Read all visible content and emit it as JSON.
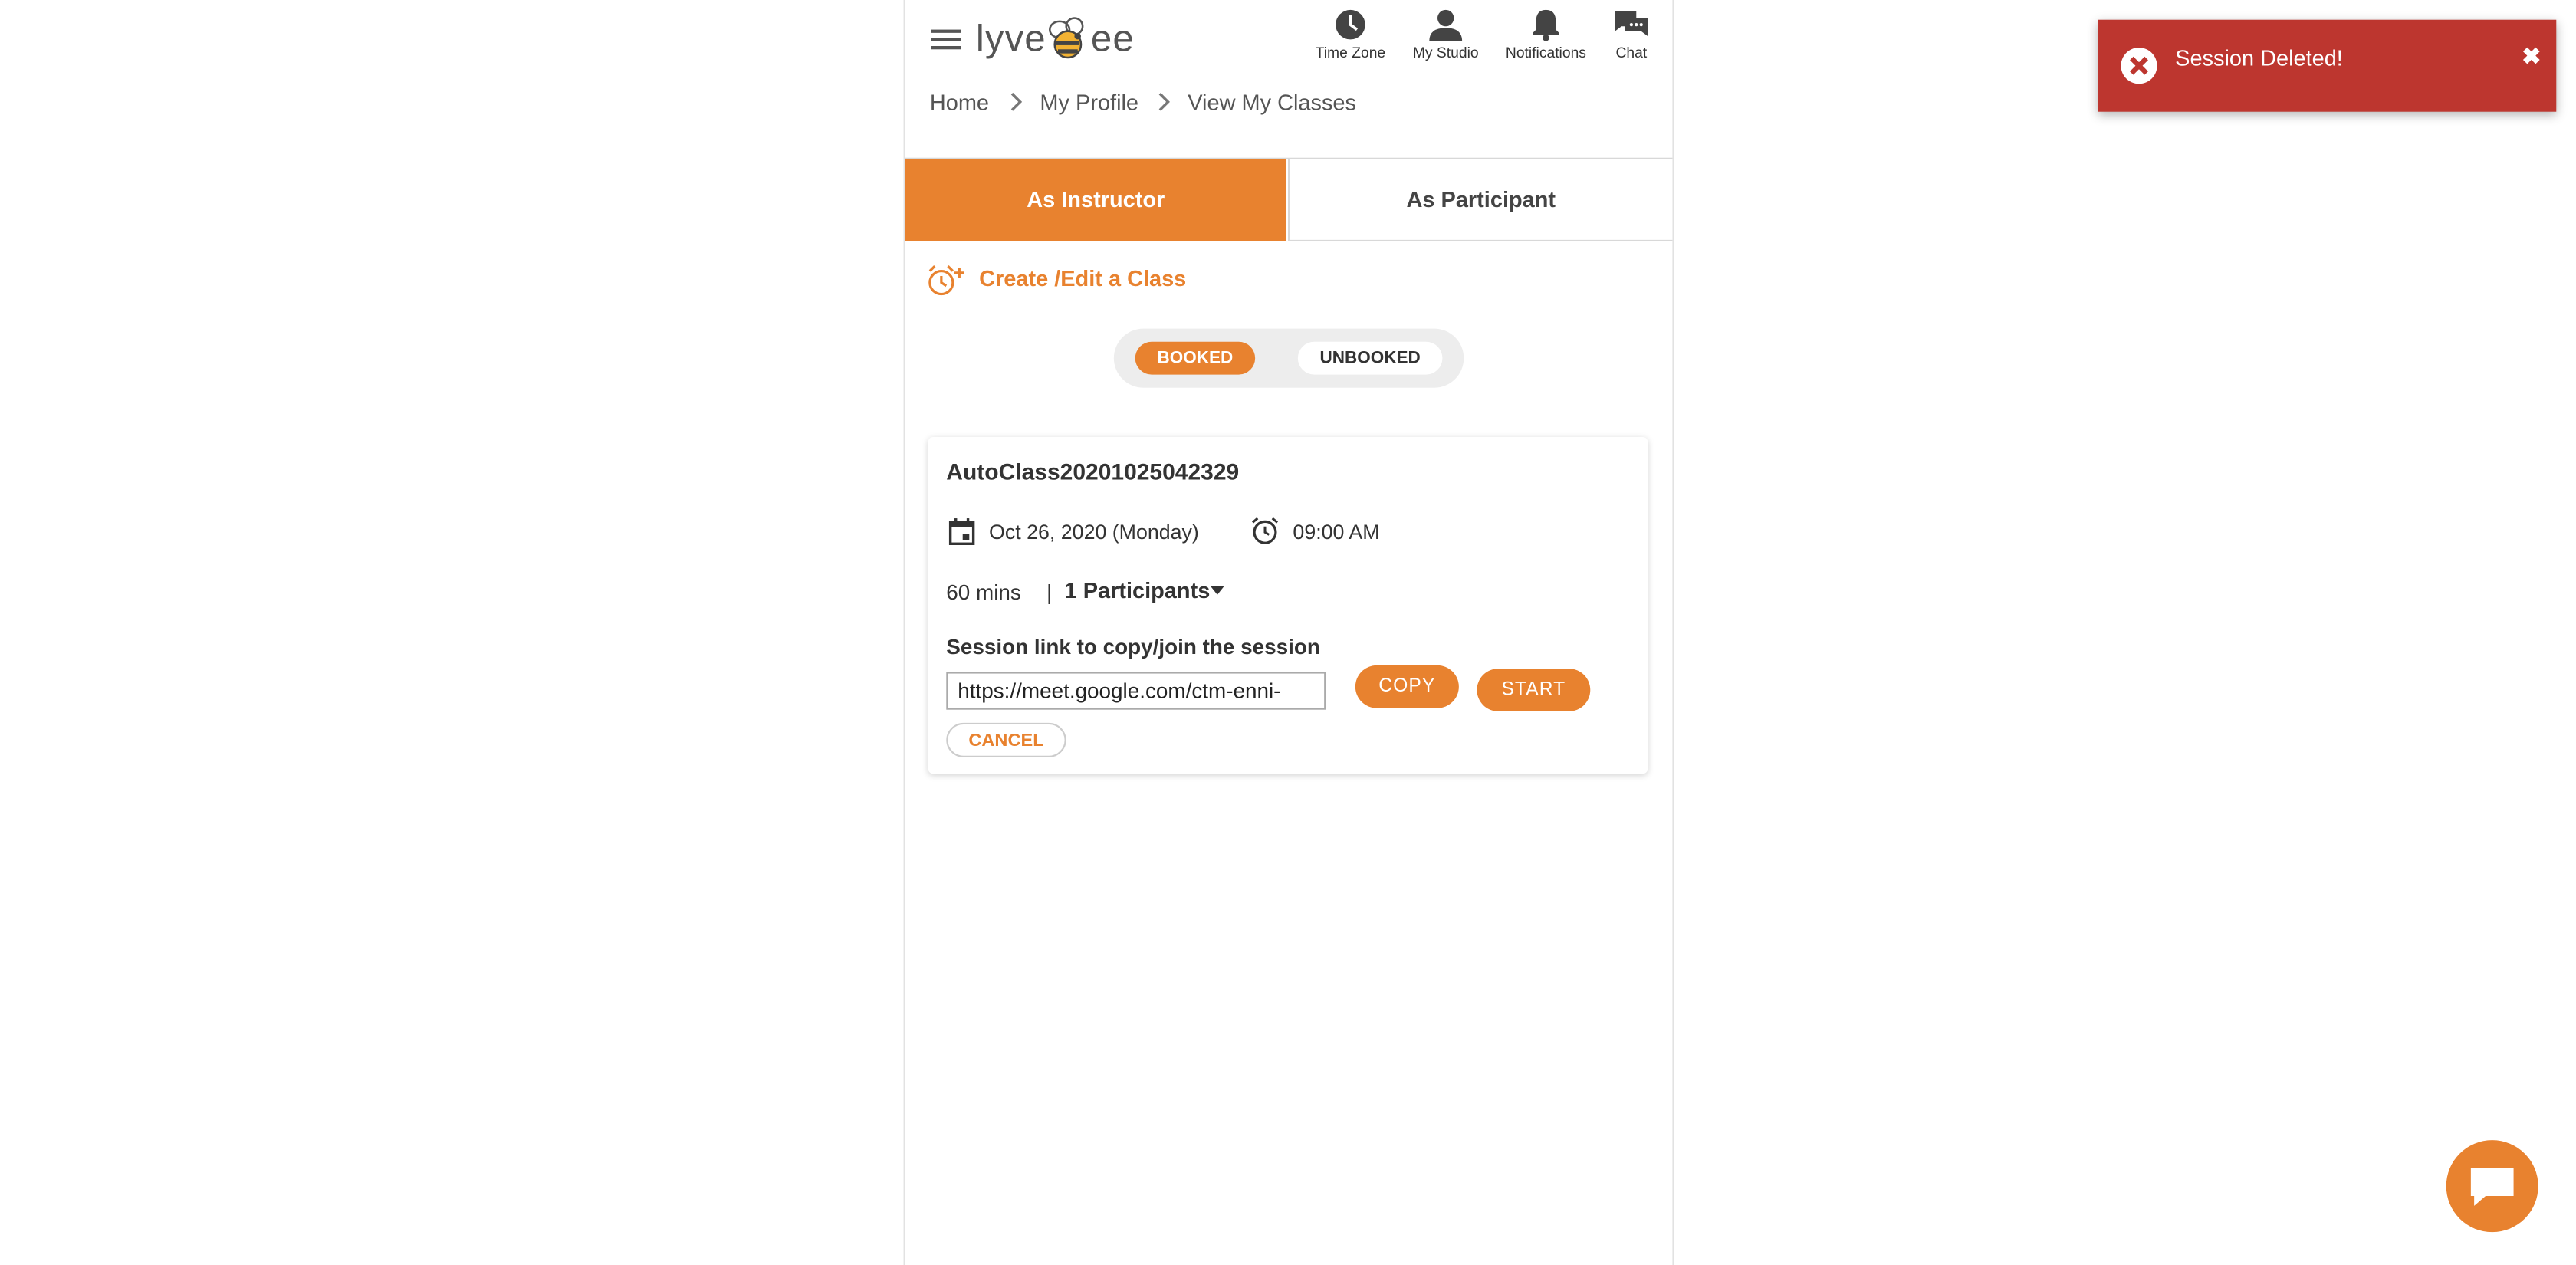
{
  "header": {
    "logo_text": "lyve",
    "logo_suffix": "ee",
    "icons": [
      {
        "label": "Time Zone",
        "icon": "clock-icon"
      },
      {
        "label": "My Studio",
        "icon": "person-icon"
      },
      {
        "label": "Notifications",
        "icon": "bell-icon"
      },
      {
        "label": "Chat",
        "icon": "chat-bubbles-icon"
      }
    ]
  },
  "breadcrumb": [
    "Home",
    "My Profile",
    "View My Classes"
  ],
  "tabs": [
    {
      "label": "As Instructor",
      "active": true
    },
    {
      "label": "As Participant",
      "active": false
    }
  ],
  "create_link": "Create /Edit a Class",
  "filter": {
    "booked": "BOOKED",
    "unbooked": "UNBOOKED",
    "selected": "BOOKED"
  },
  "class_card": {
    "title": "AutoClass20201025042329",
    "date": "Oct 26, 2020",
    "weekday": "(Monday)",
    "time": "09:00 AM",
    "duration": "60 mins",
    "separator": "|",
    "participants": "1 Participants",
    "link_label": "Session link to copy/join the session",
    "link_value": "https://meet.google.com/ctm-enni-",
    "copy_label": "COPY",
    "start_label": "START",
    "cancel_label": "CANCEL"
  },
  "toast": {
    "message": "Session Deleted!",
    "close": "✖"
  },
  "colors": {
    "accent": "#e8822f",
    "toast_bg": "#bd362f"
  }
}
